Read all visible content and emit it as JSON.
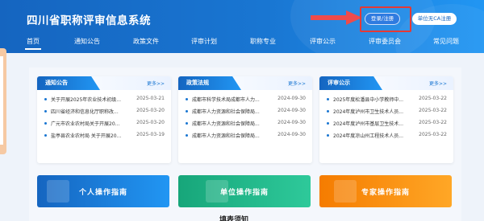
{
  "header": {
    "site_title": "四川省职称评审信息系统",
    "login_label": "登录/注册",
    "ca_register_label": "单位无CA注册"
  },
  "nav": {
    "items": [
      {
        "label": "首页"
      },
      {
        "label": "通知公告"
      },
      {
        "label": "政策文件"
      },
      {
        "label": "评审计划"
      },
      {
        "label": "职称专业"
      },
      {
        "label": "评审公示"
      },
      {
        "label": "评审委员会"
      },
      {
        "label": "常见问题"
      }
    ]
  },
  "panels": [
    {
      "title": "通知公告",
      "more": "更多>>",
      "items": [
        {
          "title": "关于开展2025年农业技术初级...",
          "date": "2025-03-21"
        },
        {
          "title": "四川省经济和信息化厅职称改...",
          "date": "2025-03-20"
        },
        {
          "title": "广元市农业农村局关于开展20...",
          "date": "2025-03-20"
        },
        {
          "title": "盐亭县农业农村局 关于开展20...",
          "date": "2025-03-19"
        }
      ]
    },
    {
      "title": "政策法规",
      "more": "更多>>",
      "items": [
        {
          "title": "成都市科学技术局成都市人力...",
          "date": "2024-09-30"
        },
        {
          "title": "成都市人力资源和社会保障局...",
          "date": "2024-09-30"
        },
        {
          "title": "成都市人力资源和社会保障局...",
          "date": "2024-09-30"
        },
        {
          "title": "成都市人力资源和社会保障局...",
          "date": "2024-09-30"
        }
      ]
    },
    {
      "title": "评审公示",
      "more": "更多>>",
      "items": [
        {
          "title": "2025年度松潘县中小学教师中...",
          "date": "2025-03-22"
        },
        {
          "title": "2024年度泸州市卫生技术人员...",
          "date": "2025-03-22"
        },
        {
          "title": "2024年度泸州市基层卫生技术...",
          "date": "2025-03-22"
        },
        {
          "title": "2024年度凉山州工程技术人员...",
          "date": "2025-03-22"
        }
      ]
    }
  ],
  "guides": [
    {
      "label": "个人操作指南",
      "color": "#1976d2"
    },
    {
      "label": "单位操作指南",
      "color": "#20b486"
    },
    {
      "label": "专家操作指南",
      "color": "#fb8c00"
    }
  ],
  "bottom_heading": "填表须知",
  "colors": {
    "primary": "#1976d2",
    "highlight": "#e53935"
  }
}
